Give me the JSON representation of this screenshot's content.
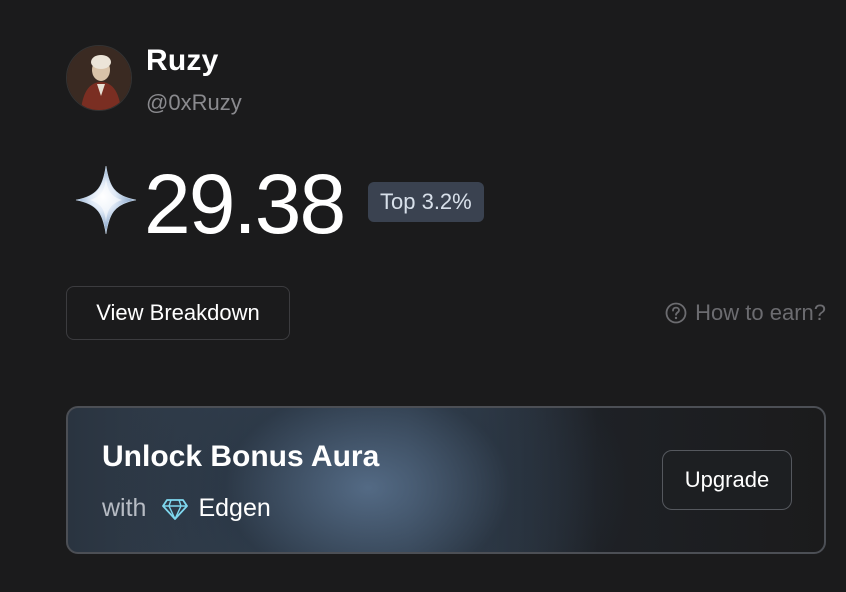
{
  "profile": {
    "name": "Ruzy",
    "handle": "@0xRuzy"
  },
  "aura": {
    "icon": "sparkle-star-icon",
    "score": "29.38",
    "rank_badge": "Top 3.2%"
  },
  "actions": {
    "view_breakdown": "View Breakdown",
    "how_to_earn": "How to earn?"
  },
  "promo": {
    "title": "Unlock Bonus Aura",
    "with_label": "with",
    "brand": "Edgen",
    "brand_icon": "diamond-icon",
    "upgrade_label": "Upgrade"
  },
  "colors": {
    "background": "#1b1b1c",
    "badge_bg": "#3a4250",
    "muted_text": "#8a8a8e",
    "gem": "#7fd8ef"
  }
}
